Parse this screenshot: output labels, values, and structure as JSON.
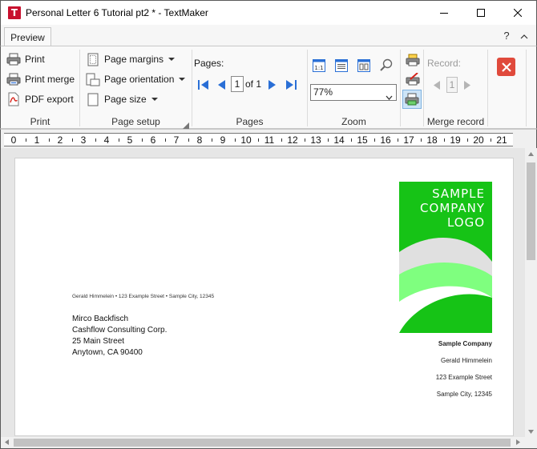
{
  "window": {
    "title": "Personal Letter 6 Tutorial pt2 * - TextMaker",
    "app_icon_letter": "T"
  },
  "tabs": [
    {
      "label": "Preview"
    }
  ],
  "tabbar": {
    "help": "?"
  },
  "ribbon": {
    "print": {
      "label": "Print",
      "items": [
        {
          "label": "Print",
          "icon": "printer-icon"
        },
        {
          "label": "Print merge",
          "icon": "print-merge-icon"
        },
        {
          "label": "PDF export",
          "icon": "pdf-icon"
        }
      ]
    },
    "page_setup": {
      "label": "Page setup",
      "items": [
        {
          "label": "Page margins",
          "icon": "page-margins-icon"
        },
        {
          "label": "Page orientation",
          "icon": "page-orientation-icon"
        },
        {
          "label": "Page size",
          "icon": "page-size-icon"
        }
      ]
    },
    "pages": {
      "label": "Pages",
      "title": "Pages:",
      "current_page": "1",
      "of_text": "of 1"
    },
    "zoom": {
      "label": "Zoom",
      "value": "77%"
    },
    "merge_record": {
      "label": "Merge record",
      "record_label": "Record:",
      "record_value": "1"
    }
  },
  "ruler": {
    "numbers": [
      "0",
      "1",
      "2",
      "3",
      "4",
      "5",
      "6",
      "7",
      "8",
      "9",
      "10",
      "11",
      "12",
      "13",
      "14",
      "15",
      "16",
      "17",
      "18",
      "19",
      "20",
      "21"
    ]
  },
  "document": {
    "logo_lines": [
      "SAMPLE",
      "COMPANY",
      "LOGO"
    ],
    "sender_line": "Gerald Himmelein • 123 Example Street • Sample City, 12345",
    "recipient": [
      "Mirco Backfisch",
      "Cashflow Consulting Corp.",
      "25 Main Street",
      "Anytown, CA 90400"
    ],
    "company_block": [
      "Sample Company",
      "Gerald Himmelein",
      "123 Example Street",
      "Sample City, 12345"
    ],
    "colors": {
      "logo_green": "#16c316",
      "logo_light_green": "#7fff7f",
      "logo_grey": "#e0e0e0"
    }
  }
}
